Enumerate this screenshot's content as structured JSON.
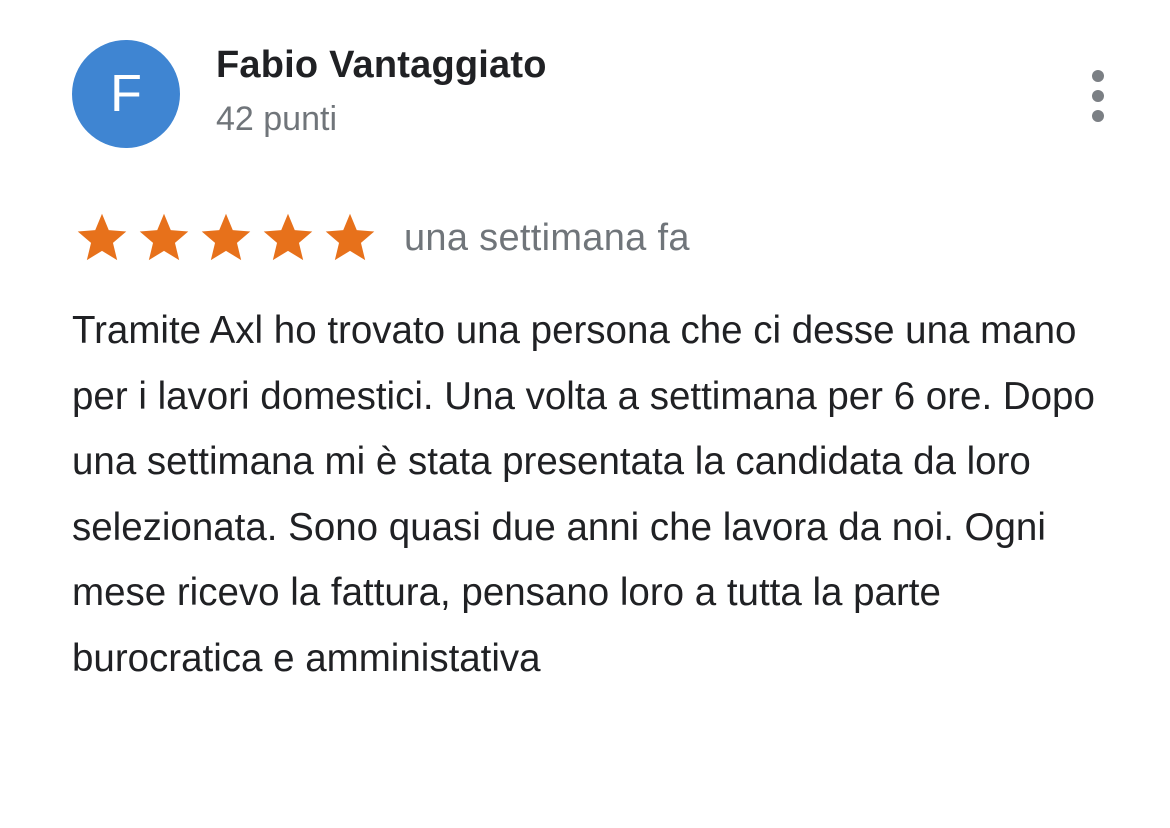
{
  "review": {
    "author": {
      "initial": "F",
      "name": "Fabio Vantaggiato",
      "points": "42 punti",
      "avatar_color": "#3f85d2"
    },
    "rating": {
      "stars": 5,
      "max_stars": 5,
      "star_color": "#e7711b",
      "star_icon": "star-icon"
    },
    "timestamp": "una settimana fa",
    "text": "Tramite Axl ho trovato una persona che ci desse una mano per i lavori domestici. Una volta a settimana per 6 ore. Dopo una settimana mi è stata presentata la candidata da loro selezionata. Sono quasi due anni che lavora da noi. Ogni mese ricevo la fattura, pensano loro a tutta la parte burocratica e amministativa",
    "menu_icon": "more-vert-icon"
  }
}
